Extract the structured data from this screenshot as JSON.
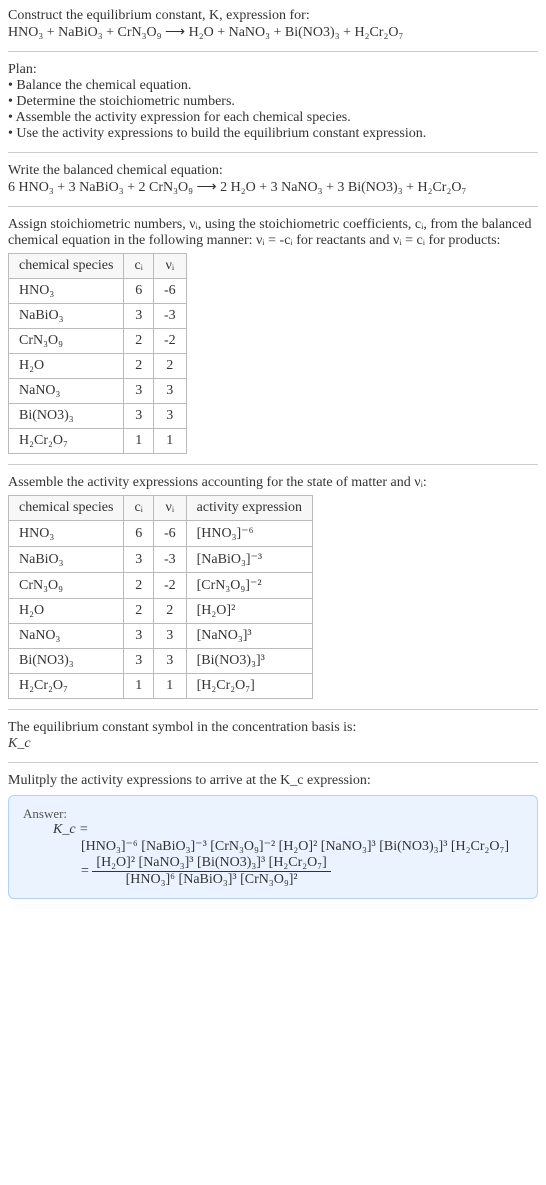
{
  "intro": {
    "line1": "Construct the equilibrium constant, K, expression for:",
    "equation": "HNO₃ + NaBiO₃ + CrN₃O₉ ⟶ H₂O + NaNO₃ + Bi(NO3)₃ + H₂Cr₂O₇"
  },
  "plan": {
    "title": "Plan:",
    "items": [
      "• Balance the chemical equation.",
      "• Determine the stoichiometric numbers.",
      "• Assemble the activity expression for each chemical species.",
      "• Use the activity expressions to build the equilibrium constant expression."
    ]
  },
  "balanced": {
    "title": "Write the balanced chemical equation:",
    "equation": "6 HNO₃ + 3 NaBiO₃ + 2 CrN₃O₉ ⟶ 2 H₂O + 3 NaNO₃ + 3 Bi(NO3)₃ + H₂Cr₂O₇"
  },
  "assign": {
    "text": "Assign stoichiometric numbers, νᵢ, using the stoichiometric coefficients, cᵢ, from the balanced chemical equation in the following manner: νᵢ = -cᵢ for reactants and νᵢ = cᵢ for products:"
  },
  "table1": {
    "headers": [
      "chemical species",
      "cᵢ",
      "νᵢ"
    ],
    "rows": [
      [
        "HNO₃",
        "6",
        "-6"
      ],
      [
        "NaBiO₃",
        "3",
        "-3"
      ],
      [
        "CrN₃O₉",
        "2",
        "-2"
      ],
      [
        "H₂O",
        "2",
        "2"
      ],
      [
        "NaNO₃",
        "3",
        "3"
      ],
      [
        "Bi(NO3)₃",
        "3",
        "3"
      ],
      [
        "H₂Cr₂O₇",
        "1",
        "1"
      ]
    ]
  },
  "assemble": {
    "text": "Assemble the activity expressions accounting for the state of matter and νᵢ:"
  },
  "table2": {
    "headers": [
      "chemical species",
      "cᵢ",
      "νᵢ",
      "activity expression"
    ],
    "rows": [
      [
        "HNO₃",
        "6",
        "-6",
        "[HNO₃]⁻⁶"
      ],
      [
        "NaBiO₃",
        "3",
        "-3",
        "[NaBiO₃]⁻³"
      ],
      [
        "CrN₃O₉",
        "2",
        "-2",
        "[CrN₃O₉]⁻²"
      ],
      [
        "H₂O",
        "2",
        "2",
        "[H₂O]²"
      ],
      [
        "NaNO₃",
        "3",
        "3",
        "[NaNO₃]³"
      ],
      [
        "Bi(NO3)₃",
        "3",
        "3",
        "[Bi(NO3)₃]³"
      ],
      [
        "H₂Cr₂O₇",
        "1",
        "1",
        "[H₂Cr₂O₇]"
      ]
    ]
  },
  "symbol": {
    "line1": "The equilibrium constant symbol in the concentration basis is:",
    "line2": "K_c"
  },
  "multiply": {
    "text": "Mulitply the activity expressions to arrive at the K_c expression:"
  },
  "answer": {
    "label": "Answer:",
    "kc": "K_c =",
    "expr1": "[HNO₃]⁻⁶ [NaBiO₃]⁻³ [CrN₃O₉]⁻² [H₂O]² [NaNO₃]³ [Bi(NO3)₃]³ [H₂Cr₂O₇]",
    "eq": "=",
    "num": "[H₂O]² [NaNO₃]³ [Bi(NO3)₃]³ [H₂Cr₂O₇]",
    "den": "[HNO₃]⁶ [NaBiO₃]³ [CrN₃O₉]²"
  }
}
